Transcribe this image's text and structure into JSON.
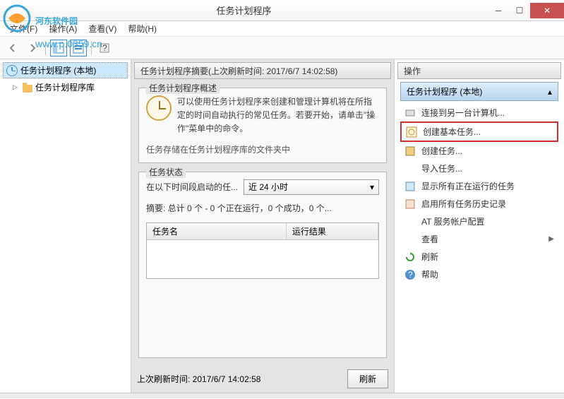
{
  "watermark": {
    "text": "河东软件园",
    "url": "www.p.0359.cn"
  },
  "window": {
    "title": "任务计划程序"
  },
  "menu": {
    "file": "文件(F)",
    "action": "操作(A)",
    "view": "查看(V)",
    "help": "帮助(H)"
  },
  "tree": {
    "root": "任务计划程序 (本地)",
    "child": "任务计划程序库"
  },
  "center": {
    "summary_bar": "任务计划程序摘要(上次刷新时间: 2017/6/7 14:02:58)",
    "overview": {
      "legend": "任务计划程序概述",
      "desc": "可以使用任务计划程序来创建和管理计算机将在所指定的时间自动执行的常见任务。若要开始，请单击\"操作\"菜单中的命令。",
      "truncated": "任务存储在任务计划程序库的文件夹中"
    },
    "status": {
      "legend": "任务状态",
      "label": "在以下时间段启动的任...",
      "select_value": "近 24 小时",
      "summary": "摘要: 总计 0 个 - 0 个正在运行，0 个成功，0 个...",
      "col_name": "任务名",
      "col_result": "运行结果"
    },
    "refresh": {
      "label": "上次刷新时间: 2017/6/7 14:02:58",
      "button": "刷新"
    }
  },
  "actions": {
    "title": "操作",
    "header": "任务计划程序 (本地)",
    "items": [
      {
        "icon": "connect",
        "label": "连接到另一台计算机..."
      },
      {
        "icon": "basic-task",
        "label": "创建基本任务...",
        "highlighted": true
      },
      {
        "icon": "task",
        "label": "创建任务..."
      },
      {
        "icon": "import",
        "label": "导入任务..."
      },
      {
        "icon": "running",
        "label": "显示所有正在运行的任务"
      },
      {
        "icon": "history",
        "label": "启用所有任务历史记录"
      },
      {
        "icon": "at",
        "label": "AT 服务帐户配置"
      },
      {
        "icon": "view",
        "label": "查看",
        "chevron": true
      },
      {
        "icon": "refresh",
        "label": "刷新"
      },
      {
        "icon": "help",
        "label": "帮助"
      }
    ]
  }
}
